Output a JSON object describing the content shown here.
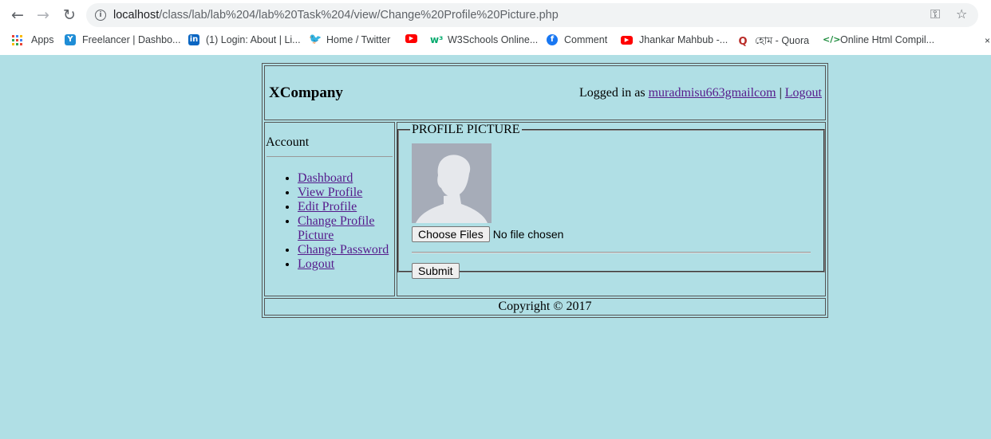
{
  "browser": {
    "url_host": "localhost",
    "url_path": "/class/lab/lab%204/lab%20Task%204/view/Change%20Profile%20Picture.php",
    "bookmarks": [
      {
        "label": "Apps",
        "icon": "apps-grid-icon"
      },
      {
        "label": "Freelancer | Dashbo...",
        "icon": "freelancer-icon"
      },
      {
        "label": "(1) Login: About | Li...",
        "icon": "linkedin-icon"
      },
      {
        "label": "Home / Twitter",
        "icon": "twitter-icon"
      },
      {
        "label": "",
        "icon": "youtube-icon"
      },
      {
        "label": "W3Schools Online...",
        "icon": "w3schools-icon"
      },
      {
        "label": "Comment",
        "icon": "facebook-icon"
      },
      {
        "label": "Jhankar Mahbub -...",
        "icon": "youtube-icon"
      },
      {
        "label": "হোম - Quora",
        "icon": "quora-icon"
      },
      {
        "label": "Online Html Compil...",
        "icon": "code-icon"
      }
    ]
  },
  "header": {
    "brand": "XCompany",
    "logged_in_prefix": "Logged in as",
    "username": "muradmisu663gmailcom",
    "separator": "|",
    "logout": "Logout"
  },
  "sidebar": {
    "title": "Account",
    "items": [
      {
        "label": "Dashboard"
      },
      {
        "label": "View Profile"
      },
      {
        "label": "Edit Profile"
      },
      {
        "label": "Change Profile Picture"
      },
      {
        "label": "Change Password"
      },
      {
        "label": "Logout"
      }
    ]
  },
  "form": {
    "legend": "PROFILE PICTURE",
    "choose_files": "Choose Files",
    "no_file": "No file chosen",
    "submit": "Submit"
  },
  "footer": {
    "copyright": "Copyright © 2017"
  },
  "colors": {
    "page_background": "#b0dfe5",
    "link": "#551a8b"
  }
}
